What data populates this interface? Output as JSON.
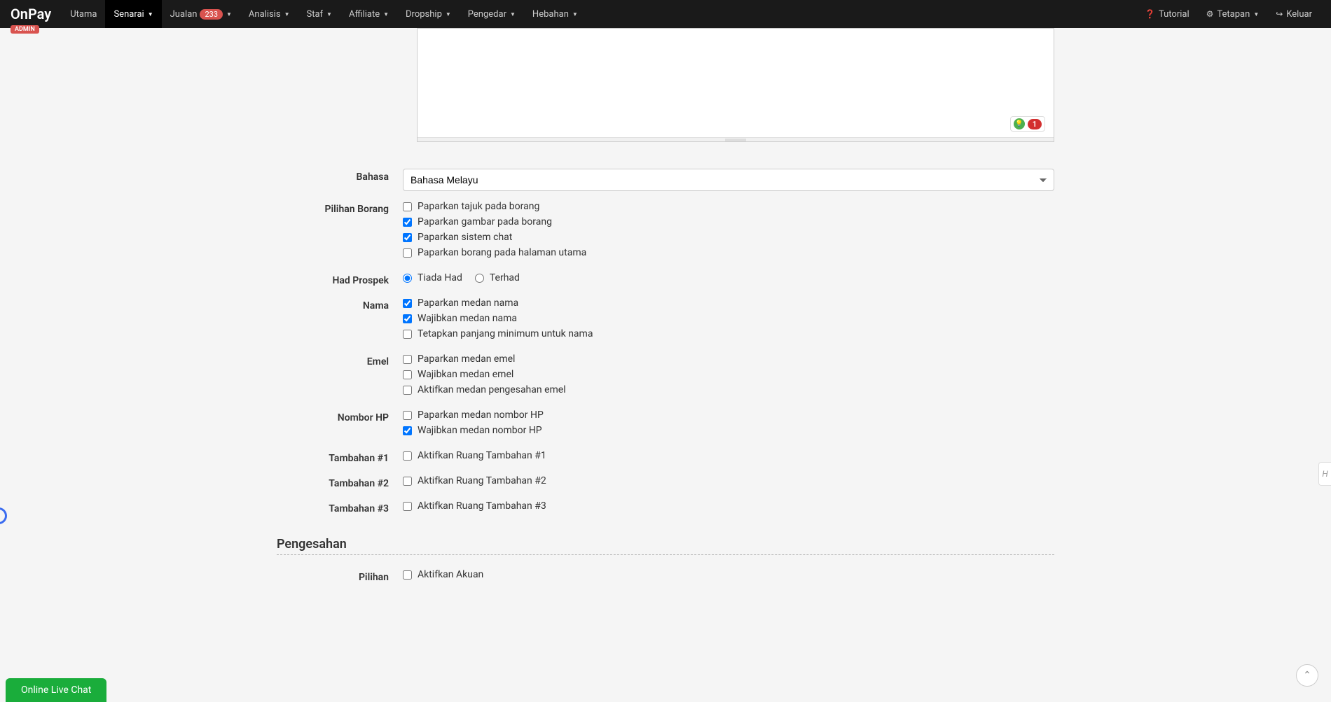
{
  "brand": "OnPay",
  "admin_badge": "ADMIN",
  "nav": {
    "utama": "Utama",
    "senarai": "Senarai",
    "jualan": "Jualan",
    "jualan_badge": "233",
    "analisis": "Analisis",
    "staf": "Staf",
    "affiliate": "Affiliate",
    "dropship": "Dropship",
    "pengedar": "Pengedar",
    "hebahan": "Hebahan",
    "tutorial": "Tutorial",
    "tetapan": "Tetapan",
    "keluar": "Keluar"
  },
  "editor": {
    "badge_count": "1"
  },
  "form": {
    "bahasa": {
      "label": "Bahasa",
      "value": "Bahasa Melayu"
    },
    "pilihan_borang": {
      "label": "Pilihan Borang",
      "options": [
        {
          "label": "Paparkan tajuk pada borang",
          "checked": false
        },
        {
          "label": "Paparkan gambar pada borang",
          "checked": true
        },
        {
          "label": "Paparkan sistem chat",
          "checked": true
        },
        {
          "label": "Paparkan borang pada halaman utama",
          "checked": false
        }
      ]
    },
    "had_prospek": {
      "label": "Had Prospek",
      "tiada_had": "Tiada Had",
      "terhad": "Terhad"
    },
    "nama": {
      "label": "Nama",
      "options": [
        {
          "label": "Paparkan medan nama",
          "checked": true
        },
        {
          "label": "Wajibkan medan nama",
          "checked": true
        },
        {
          "label": "Tetapkan panjang minimum untuk nama",
          "checked": false
        }
      ]
    },
    "emel": {
      "label": "Emel",
      "options": [
        {
          "label": "Paparkan medan emel",
          "checked": false
        },
        {
          "label": "Wajibkan medan emel",
          "checked": false
        },
        {
          "label": "Aktifkan medan pengesahan emel",
          "checked": false
        }
      ]
    },
    "nombor_hp": {
      "label": "Nombor HP",
      "options": [
        {
          "label": "Paparkan medan nombor HP",
          "checked": false
        },
        {
          "label": "Wajibkan medan nombor HP",
          "checked": true
        }
      ]
    },
    "tambahan1": {
      "label": "Tambahan #1",
      "option": "Aktifkan Ruang Tambahan #1"
    },
    "tambahan2": {
      "label": "Tambahan #2",
      "option": "Aktifkan Ruang Tambahan #2"
    },
    "tambahan3": {
      "label": "Tambahan #3",
      "option": "Aktifkan Ruang Tambahan #3"
    },
    "pengesahan": {
      "title": "Pengesahan",
      "pilihan_label": "Pilihan",
      "option": "Aktifkan Akuan"
    }
  },
  "chat": "Online Live Chat",
  "side_tab": "H"
}
